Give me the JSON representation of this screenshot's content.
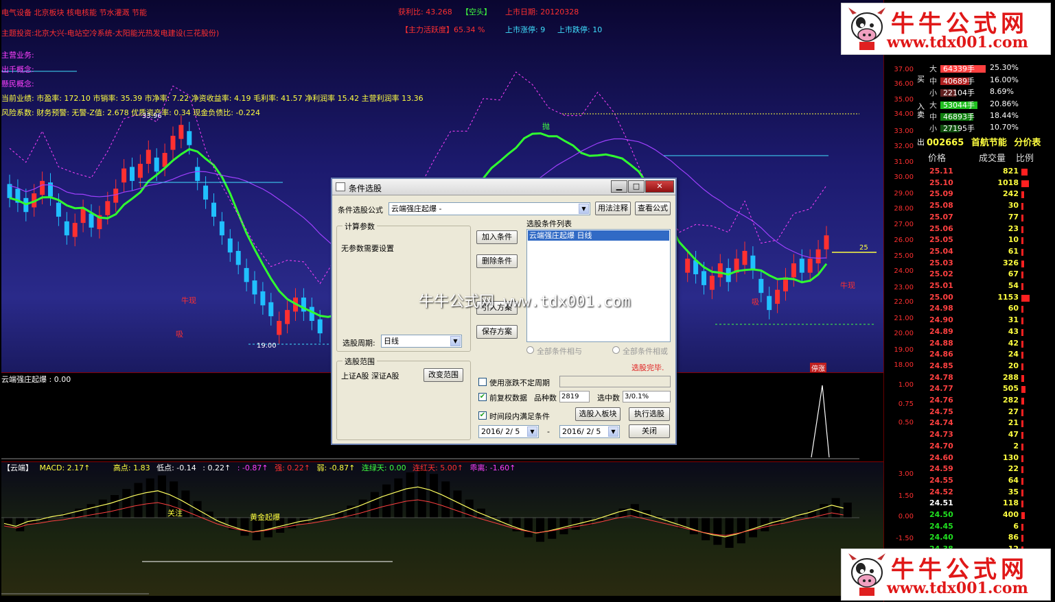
{
  "main_info": {
    "top_left": "电气设备 北京板块 核电核能 节水灌溉 节能",
    "stat1": "获利比: 43.268",
    "stat1_tag": "【空头】",
    "listing": "上市日期: 20120328",
    "theme": "主题投资:北京大兴-电站空冷系统-太阳能光热发电建设(三花股份)",
    "activity": "【主力活跃度】65.34 %",
    "limit_up": "上市涨停: 9",
    "limit_down": "上市跌停: 10",
    "business": "主营业务:",
    "concept1": "出千概念:",
    "concept2": "懸民概念:",
    "perf": "当前业绩: 市盈率: 172.10 市销率: 35.39 市净率: 7.22 净资收益率: 4.19 毛利率: 41.57 净利润率 15.42 主营利润率 13.36",
    "risk": "风险系数: 财务预警: 无警-Z值: 2.678 优质资产率: 0.34 现金负债比: -0.224",
    "label_high": "33.96",
    "label_low": "19.00",
    "label_25": "25",
    "mk_pao": "抛",
    "mk_niu1": "牛现",
    "mk_niu2": "牛现",
    "mk_xi1": "吸",
    "mk_xi2": "吸",
    "mk_ting": "停涨"
  },
  "price_axis": [
    "37.00",
    "36.00",
    "35.00",
    "34.00",
    "33.00",
    "32.00",
    "31.00",
    "30.00",
    "29.00",
    "28.00",
    "27.00",
    "26.00",
    "25.00",
    "24.00",
    "23.00",
    "22.00",
    "21.00",
    "20.00",
    "19.00",
    "18.00"
  ],
  "sub_axis": [
    "1.00",
    "0.75",
    "0.50"
  ],
  "macd_axis": [
    "3.00",
    "1.50",
    "0.00",
    "-1.50"
  ],
  "sub_label": "云端强庄起爆 : 0.00",
  "macd_head": {
    "name": "【云端】",
    "macd": "MACD: 2.17↑",
    "high": "高点: 1.83",
    "low": "低点: -0.14",
    "v1": ": 0.22↑",
    "v2": ": -0.87↑",
    "strong": "强: 0.22↑",
    "weak": "弱: -0.87↑",
    "green": "连绿天: 0.00",
    "red": "连红天: 5.00↑",
    "away": "乖离: -1.60↑",
    "mk_focus": "关注",
    "mk_gold": "黄金起爆"
  },
  "logo": {
    "name": "牛牛公式网",
    "url": "www.tdx001.com"
  },
  "order_book": {
    "buy_side": "买入",
    "sell_side": "卖出",
    "rows": [
      {
        "lvl": "大",
        "vol": "64339手",
        "pct": "25.30%",
        "color": "#ff4040"
      },
      {
        "lvl": "中",
        "vol": "40689手",
        "pct": "16.00%",
        "color": "#b02020"
      },
      {
        "lvl": "小",
        "vol": "22104手",
        "pct": "8.69%",
        "color": "#602020"
      },
      {
        "lvl": "大",
        "vol": "53044手",
        "pct": "20.86%",
        "color": "#20c020"
      },
      {
        "lvl": "中",
        "vol": "46893手",
        "pct": "18.44%",
        "color": "#108010"
      },
      {
        "lvl": "小",
        "vol": "27195手",
        "pct": "10.70%",
        "color": "#105010"
      }
    ]
  },
  "stock": {
    "code": "002665",
    "name": "首航节能",
    "table": "分价表"
  },
  "tick_head": {
    "price": "价格",
    "volume": "成交量",
    "ratio": "比例"
  },
  "ticks": [
    {
      "p": "25.11",
      "v": "821",
      "w": 9,
      "c": "#ff4040"
    },
    {
      "p": "25.10",
      "v": "1018",
      "w": 11,
      "c": "#ff4040"
    },
    {
      "p": "25.09",
      "v": "242",
      "w": 2,
      "c": "#ff4040"
    },
    {
      "p": "25.08",
      "v": "30",
      "w": 1,
      "c": "#ff4040"
    },
    {
      "p": "25.07",
      "v": "77",
      "w": 1,
      "c": "#ff4040"
    },
    {
      "p": "25.06",
      "v": "23",
      "w": 1,
      "c": "#ff4040"
    },
    {
      "p": "25.05",
      "v": "10",
      "w": 1,
      "c": "#ff4040"
    },
    {
      "p": "25.04",
      "v": "61",
      "w": 1,
      "c": "#ff4040"
    },
    {
      "p": "25.03",
      "v": "326",
      "w": 3,
      "c": "#ff4040"
    },
    {
      "p": "25.02",
      "v": "67",
      "w": 1,
      "c": "#ff4040"
    },
    {
      "p": "25.01",
      "v": "54",
      "w": 1,
      "c": "#ff4040"
    },
    {
      "p": "25.00",
      "v": "1153",
      "w": 12,
      "c": "#ff4040"
    },
    {
      "p": "24.98",
      "v": "60",
      "w": 1,
      "c": "#ff4040"
    },
    {
      "p": "24.90",
      "v": "31",
      "w": 1,
      "c": "#ff4040"
    },
    {
      "p": "24.89",
      "v": "43",
      "w": 1,
      "c": "#ff4040"
    },
    {
      "p": "24.88",
      "v": "42",
      "w": 1,
      "c": "#ff4040"
    },
    {
      "p": "24.86",
      "v": "24",
      "w": 1,
      "c": "#ff4040"
    },
    {
      "p": "24.85",
      "v": "20",
      "w": 1,
      "c": "#ff4040"
    },
    {
      "p": "24.78",
      "v": "288",
      "w": 3,
      "c": "#ff4040"
    },
    {
      "p": "24.77",
      "v": "505",
      "w": 5,
      "c": "#ff4040"
    },
    {
      "p": "24.76",
      "v": "282",
      "w": 3,
      "c": "#ff4040"
    },
    {
      "p": "24.75",
      "v": "27",
      "w": 1,
      "c": "#ff4040"
    },
    {
      "p": "24.74",
      "v": "21",
      "w": 1,
      "c": "#ff4040"
    },
    {
      "p": "24.73",
      "v": "47",
      "w": 1,
      "c": "#ff4040"
    },
    {
      "p": "24.70",
      "v": "2",
      "w": 1,
      "c": "#ff4040"
    },
    {
      "p": "24.60",
      "v": "130",
      "w": 1,
      "c": "#ff4040"
    },
    {
      "p": "24.59",
      "v": "22",
      "w": 1,
      "c": "#ff4040"
    },
    {
      "p": "24.55",
      "v": "64",
      "w": 1,
      "c": "#ff4040"
    },
    {
      "p": "24.52",
      "v": "35",
      "w": 1,
      "c": "#ff4040"
    },
    {
      "p": "24.51",
      "v": "118",
      "w": 1,
      "c": "#ffffff"
    },
    {
      "p": "24.50",
      "v": "400",
      "w": 4,
      "c": "#20e020"
    },
    {
      "p": "24.45",
      "v": "6",
      "w": 1,
      "c": "#20e020"
    },
    {
      "p": "24.40",
      "v": "86",
      "w": 1,
      "c": "#20e020"
    },
    {
      "p": "24.38",
      "v": "12",
      "w": 1,
      "c": "#20e020"
    }
  ],
  "dialog": {
    "title": "条件选股",
    "min": "▁",
    "max": "□",
    "close": "✕",
    "formula_label": "条件选股公式",
    "formula_value": "云端强庄起爆 -",
    "btn_usage": "用法注释",
    "btn_view": "查看公式",
    "param_group": "计算参数",
    "param_text": "无参数需要设置",
    "period_label": "选股周期:",
    "period_value": "日线",
    "list_title": "选股条件列表",
    "list_item": "云端强庄起爆    日线",
    "btn_add": "加入条件",
    "btn_del": "删除条件",
    "btn_import": "引入方案",
    "btn_save": "保存方案",
    "radio_and": "全部条件相与",
    "radio_or": "全部条件相或",
    "range_group": "选股范围",
    "range_text": "上证A股  深证A股",
    "btn_range": "改变范围",
    "done": "选股完毕.",
    "chk1": "使用涨跌不定周期",
    "chk2": "前复权数据",
    "count_label": "品种数",
    "count_value": "2819",
    "hit_label": "选中数",
    "hit_value": "3/0.1%",
    "chk3": "时间段内满足条件",
    "btn_block": "选股入板块",
    "btn_run": "执行选股",
    "date_from": "2016/ 2/ 5",
    "date_to": "2016/ 2/ 5",
    "dash": "-",
    "btn_close": "关闭"
  },
  "watermark": "牛牛公式网 www.tdx001.com"
}
